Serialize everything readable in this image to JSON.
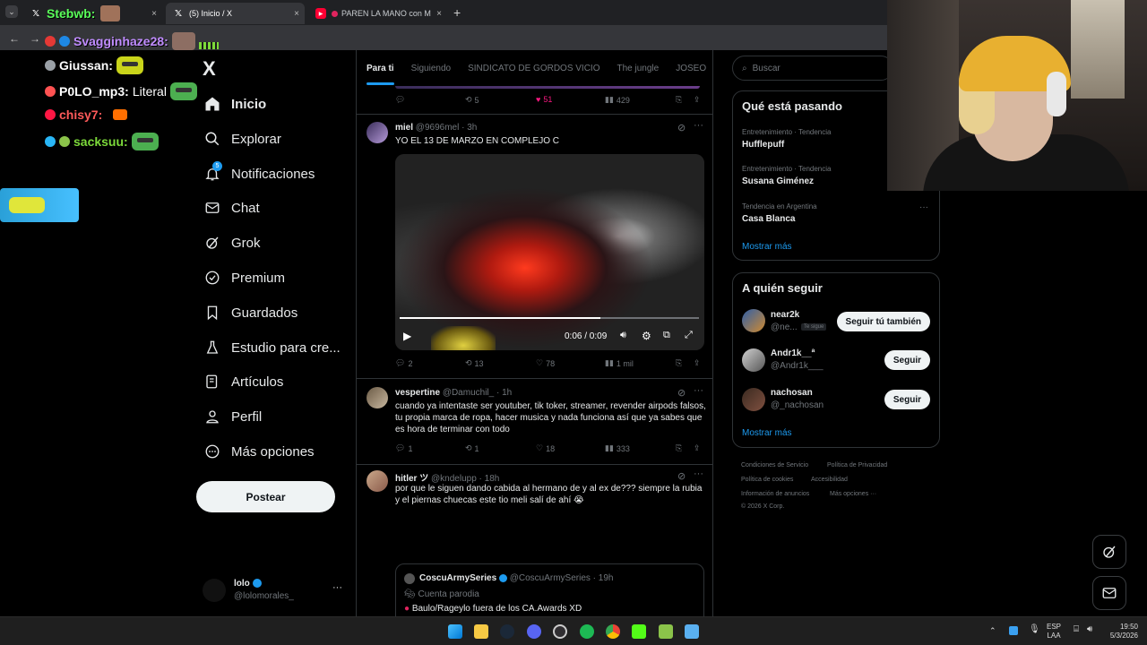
{
  "browser": {
    "tabs": [
      {
        "label": "Stebwb:",
        "active": false
      },
      {
        "label": "(5) Inicio / X",
        "active": true
      },
      {
        "label": "PAREN LA MANO con MAR",
        "active": false
      }
    ],
    "new_tab": "+",
    "close": "×"
  },
  "stream_chat": [
    {
      "user": "Svagginhaze28:",
      "text": ""
    },
    {
      "user": "Giussan:",
      "text": ""
    },
    {
      "user": "P0LO_mp3:",
      "text": "Literal"
    },
    {
      "user": "chisy7:",
      "text": ""
    },
    {
      "user": "sacksuu:",
      "text": ""
    }
  ],
  "sidebar": {
    "logo": "X",
    "items": [
      {
        "label": "Inicio",
        "icon": "home-icon"
      },
      {
        "label": "Explorar",
        "icon": "search-icon"
      },
      {
        "label": "Notificaciones",
        "icon": "bell-icon",
        "badge": "5"
      },
      {
        "label": "Chat",
        "icon": "mail-icon"
      },
      {
        "label": "Grok",
        "icon": "grok-icon"
      },
      {
        "label": "Premium",
        "icon": "premium-icon"
      },
      {
        "label": "Guardados",
        "icon": "bookmark-icon"
      },
      {
        "label": "Estudio para cre...",
        "icon": "studio-icon"
      },
      {
        "label": "Artículos",
        "icon": "articles-icon"
      },
      {
        "label": "Perfil",
        "icon": "profile-icon"
      },
      {
        "label": "Más opciones",
        "icon": "more-icon"
      }
    ],
    "post_button": "Postear",
    "account": {
      "name": "lolo",
      "handle": "@lolomorales_",
      "menu": "···"
    }
  },
  "feed": {
    "tabs": [
      "Para ti",
      "Siguiendo",
      "SINDICATO DE GORDOS VICIO",
      "The jungle",
      "JOSEO"
    ],
    "top_actions": {
      "retweets": "5",
      "likes": "51",
      "views": "429"
    },
    "posts": [
      {
        "name": "miel",
        "handle": "@9696mel",
        "time": "· 3h",
        "text": "YO EL 13 DE MARZO EN COMPLEJO C",
        "video_time": "0:06 / 0:09",
        "video_progress": 0.67,
        "replies": "2",
        "retweets": "13",
        "likes": "78",
        "views": "1 mil"
      },
      {
        "name": "vespertine",
        "handle": "@Damuchil_",
        "time": "· 1h",
        "text": "cuando ya intentaste ser youtuber, tik toker, streamer, revender airpods falsos, tu propia marca de ropa, hacer musica y nada funciona así que ya sabes que es hora de terminar con todo",
        "replies": "1",
        "retweets": "1",
        "likes": "18",
        "views": "333"
      },
      {
        "name": "hitler ツ",
        "handle": "@kndelupp",
        "time": "· 18h",
        "text": "por que le siguen dando cabida al hermano de y al ex de??? siempre la rubia y el piernas chuecas este tio meli salí de ahí 😭",
        "quote": {
          "name": "CoscuArmySeries",
          "handle": "@CoscuArmySeries",
          "time": "· 19h",
          "label": "Cuenta parodia",
          "text": "Baulo/Rageylo fuera de los CA.Awards  XD"
        }
      }
    ]
  },
  "right": {
    "search_placeholder": "Buscar",
    "trends_title": "Qué está pasando",
    "trends": [
      {
        "meta": "Entretenimiento · Tendencia",
        "name": "Hufflepuff"
      },
      {
        "meta": "Entretenimiento · Tendencia",
        "name": "Susana Giménez"
      },
      {
        "meta": "Tendencia en Argentina",
        "name": "Casa Blanca"
      }
    ],
    "trends_more": "Mostrar más",
    "follow_title": "A quién seguir",
    "follow": [
      {
        "name": "near2k",
        "handle": "@ne...",
        "note": "Te sigue",
        "button": "Seguir tú también"
      },
      {
        "name": "Andr1k__ª",
        "handle": "@Andr1k___",
        "note": "",
        "button": "Seguir"
      },
      {
        "name": "nachosan",
        "handle": "@_nachosan",
        "note": "",
        "button": "Seguir"
      }
    ],
    "follow_more": "Mostrar más",
    "footer": [
      "Condiciones de Servicio",
      "Política de Privacidad",
      "Política de cookies",
      "Accesibilidad",
      "Información de anuncios",
      "Más opciones ···",
      "© 2026 X Corp."
    ]
  },
  "taskbar": {
    "lang": "ESP",
    "lang2": "LAA",
    "time": "19:50",
    "date": "5/3/2026"
  },
  "colors": {
    "accent": "#1d9bf0",
    "like": "#f91880",
    "border": "#2f3336",
    "muted": "#71767b"
  }
}
